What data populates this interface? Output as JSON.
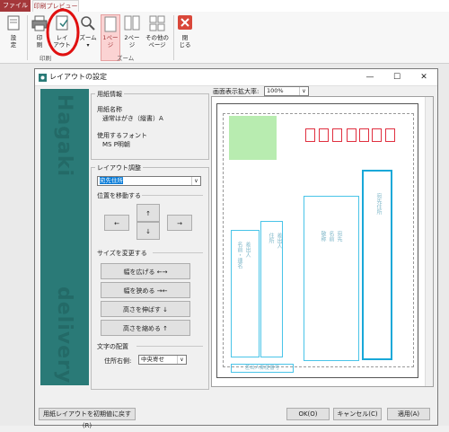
{
  "ribbon": {
    "tab_file": "ファイル",
    "tab_print_preview": "印刷プレビュー",
    "buttons": {
      "settings": "設\n定",
      "print": "印\n刷",
      "layout": "レイ\nアウト",
      "zoom": "ズーム",
      "one_page": "1ペー\nジ",
      "two_pages": "2ペー\nジ",
      "other_pages": "その他の\nページ",
      "close": "閉\nじる"
    },
    "groups": {
      "print": "印刷",
      "zoom": "ズーム"
    }
  },
  "dialog": {
    "title": "レイアウトの設定",
    "paper_info": {
      "section": "用紙情報",
      "paper_name_label": "用紙名称",
      "paper_name_value": "通常はがき（縦書）A",
      "font_label": "使用するフォント",
      "font_value": "MS P明朝"
    },
    "layout_adjust": {
      "section": "レイアウト調整",
      "field_select": "宛先住所",
      "move_label": "位置を移動する",
      "up": "↑",
      "down": "↓",
      "left": "←",
      "right": "→",
      "resize_label": "サイズを変更する",
      "widen": "幅を広げる ←→",
      "narrow": "幅を狭める →←",
      "taller": "高さを伸ばす ↓",
      "shorter": "高さを縮める ↑",
      "text_align_label": "文字の配置",
      "address_column_label": "住所右側:",
      "address_column_value": "中央寄せ"
    },
    "zoom_label": "画面表示拡大率:",
    "zoom_value": "100%",
    "preview": {
      "addressee_address": "宛先住所",
      "addressee_name": "宛先\n名前\n敬称",
      "sender_address": "差出人\n住所",
      "sender_name": "差出人\n名前・連名",
      "sender_zip": "差出人郵便番号"
    },
    "reset_button": "用紙レイアウトを初期値に戻す(R)",
    "ok_button": "OK(O)",
    "cancel_button": "キャンセル(C)",
    "apply_button": "適用(A)"
  },
  "colors": {
    "accent": "#a4373a",
    "teal": "#2a7a77",
    "highlight": "#e03030",
    "field": "#49c4e8",
    "stamp": "#b8ecb0"
  }
}
